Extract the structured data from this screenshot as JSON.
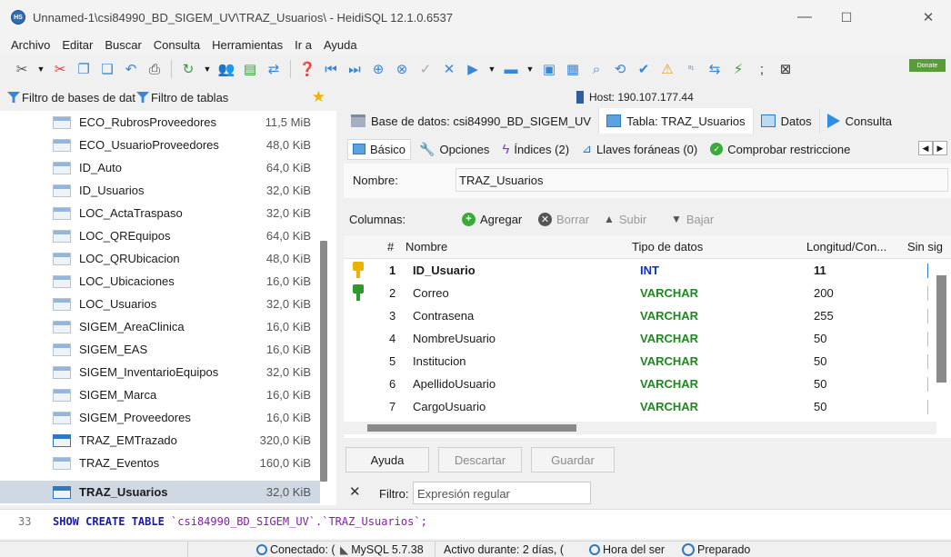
{
  "window": {
    "title": "Unnamed-1\\csi84990_BD_SIGEM_UV\\TRAZ_Usuarios\\ - HeidiSQL 12.1.0.6537",
    "app_icon": "HS",
    "minimize": "—",
    "maximize": "☐",
    "close": "✕"
  },
  "menu": [
    "Archivo",
    "Editar",
    "Buscar",
    "Consulta",
    "Herramientas",
    "Ir a",
    "Ayuda"
  ],
  "toolbar": {
    "donate_label": "Donate"
  },
  "left_panel": {
    "filter_db_placeholder": "Filtro de bases de dat",
    "filter_tables_placeholder": "Filtro de tablas",
    "tables": [
      {
        "name": "ECO_RubrosProveedores",
        "size": "11,5 MiB"
      },
      {
        "name": "ECO_UsuarioProveedores",
        "size": "48,0 KiB"
      },
      {
        "name": "ID_Auto",
        "size": "64,0 KiB"
      },
      {
        "name": "ID_Usuarios",
        "size": "32,0 KiB"
      },
      {
        "name": "LOC_ActaTraspaso",
        "size": "32,0 KiB"
      },
      {
        "name": "LOC_QREquipos",
        "size": "64,0 KiB"
      },
      {
        "name": "LOC_QRUbicacion",
        "size": "48,0 KiB"
      },
      {
        "name": "LOC_Ubicaciones",
        "size": "16,0 KiB"
      },
      {
        "name": "LOC_Usuarios",
        "size": "32,0 KiB"
      },
      {
        "name": "SIGEM_AreaClinica",
        "size": "16,0 KiB"
      },
      {
        "name": "SIGEM_EAS",
        "size": "16,0 KiB"
      },
      {
        "name": "SIGEM_InventarioEquipos",
        "size": "32,0 KiB"
      },
      {
        "name": "SIGEM_Marca",
        "size": "16,0 KiB"
      },
      {
        "name": "SIGEM_Proveedores",
        "size": "16,0 KiB"
      },
      {
        "name": "TRAZ_EMTrazado",
        "size": "320,0 KiB"
      },
      {
        "name": "TRAZ_Eventos",
        "size": "160,0 KiB"
      },
      {
        "name": "TRAZ_Usuarios",
        "size": "32,0 KiB"
      }
    ],
    "selected": "TRAZ_Usuarios"
  },
  "host": "Host: 190.107.177.44",
  "tabs": {
    "database": "Base de datos: csi84990_BD_SIGEM_UV",
    "table": "Tabla: TRAZ_Usuarios",
    "data": "Datos",
    "query": "Consulta"
  },
  "subtabs": {
    "basic": "Básico",
    "options": "Opciones",
    "indexes": "Índices (2)",
    "foreign_keys": "Llaves foráneas (0)",
    "check": "Comprobar restriccione"
  },
  "table_name": {
    "label": "Nombre:",
    "value": "TRAZ_Usuarios"
  },
  "columns_bar": {
    "label": "Columnas:",
    "add": "Agregar",
    "delete": "Borrar",
    "up": "Subir",
    "down": "Bajar"
  },
  "grid": {
    "headers": {
      "num": "#",
      "name": "Nombre",
      "type": "Tipo de datos",
      "length": "Longitud/Con...",
      "unsigned": "Sin sig"
    },
    "rows": [
      {
        "num": "1",
        "name": "ID_Usuario",
        "type": "INT",
        "length": "11",
        "key": "primary"
      },
      {
        "num": "2",
        "name": "Correo",
        "type": "VARCHAR",
        "length": "200",
        "key": "unique"
      },
      {
        "num": "3",
        "name": "Contrasena",
        "type": "VARCHAR",
        "length": "255",
        "key": ""
      },
      {
        "num": "4",
        "name": "NombreUsuario",
        "type": "VARCHAR",
        "length": "50",
        "key": ""
      },
      {
        "num": "5",
        "name": "Institucion",
        "type": "VARCHAR",
        "length": "50",
        "key": ""
      },
      {
        "num": "6",
        "name": "ApellidoUsuario",
        "type": "VARCHAR",
        "length": "50",
        "key": ""
      },
      {
        "num": "7",
        "name": "CargoUsuario",
        "type": "VARCHAR",
        "length": "50",
        "key": ""
      }
    ]
  },
  "buttons": {
    "help": "Ayuda",
    "discard": "Descartar",
    "save": "Guardar"
  },
  "filter": {
    "label": "Filtro:",
    "placeholder": "Expresión regular"
  },
  "query_log": {
    "line": "33",
    "keyword": "SHOW CREATE TABLE ",
    "target": "`csi84990_BD_SIGEM_UV`.`TRAZ_Usuarios`;"
  },
  "status": {
    "connected": "Conectado: (",
    "server": "MySQL 5.7.38",
    "uptime": "Activo durante: 2 días, (",
    "server_time": "Hora del ser",
    "state": "Preparado"
  },
  "colors": {
    "int_type": "#0a2fd6",
    "varchar_type": "#1e8a1e",
    "selection": "#cfd8e3",
    "primary_key": "#e8b400",
    "unique_key": "#2e9a2e"
  }
}
